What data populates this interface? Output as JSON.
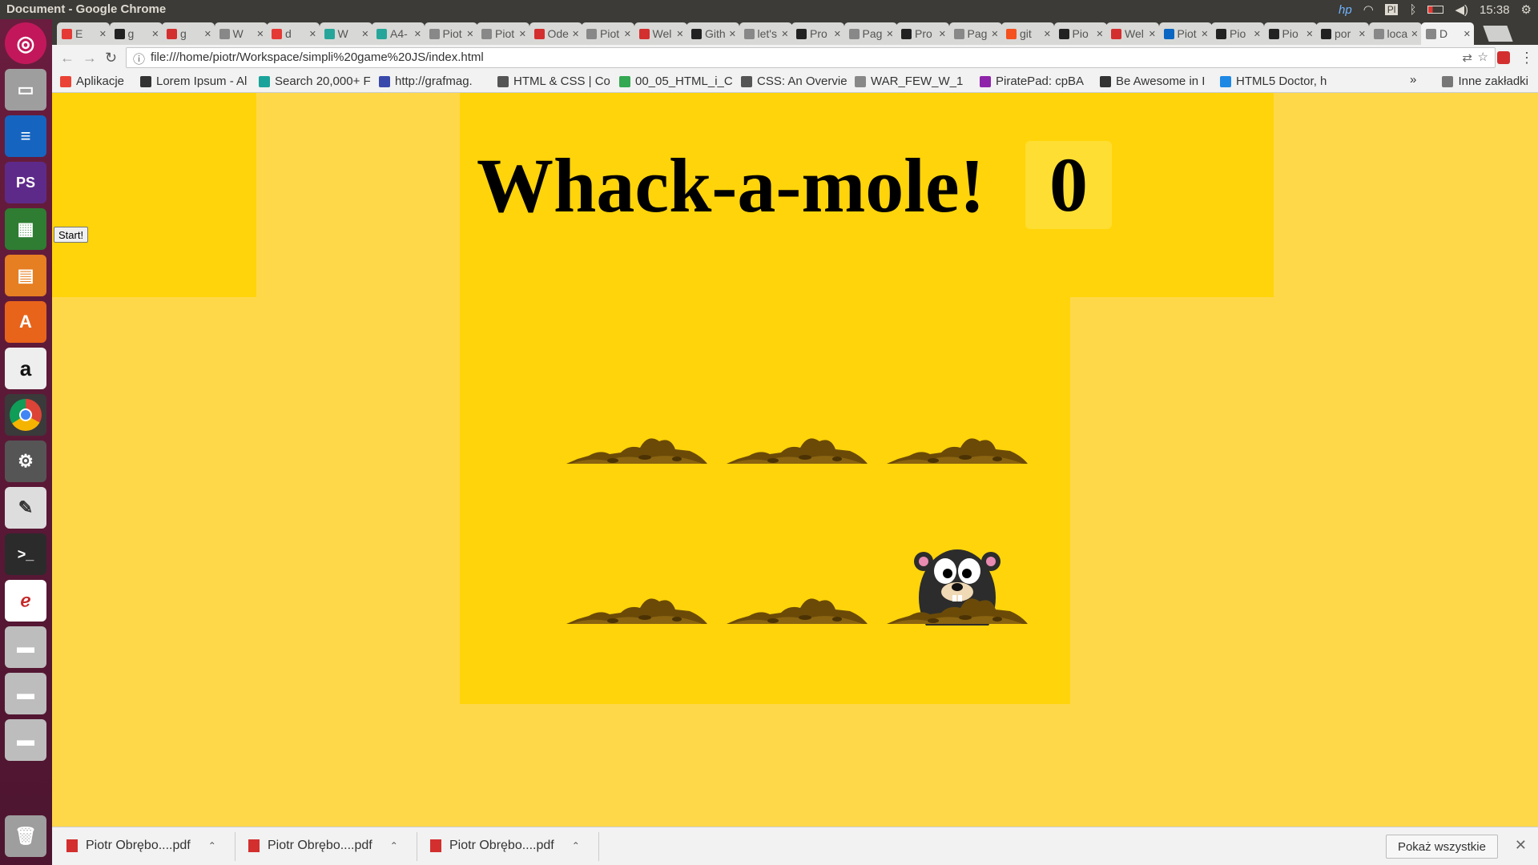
{
  "os": {
    "window_title": "Document - Google Chrome",
    "time": "15:38",
    "keyboard": "Pl"
  },
  "tabs": [
    {
      "label": "E",
      "color": "#e53935"
    },
    {
      "label": "g",
      "color": "#222"
    },
    {
      "label": "g",
      "color": "#d32f2f"
    },
    {
      "label": "W",
      "color": "#888"
    },
    {
      "label": "d",
      "color": "#e53935"
    },
    {
      "label": "W",
      "color": "#26a69a"
    },
    {
      "label": "A4-",
      "color": "#26a69a"
    },
    {
      "label": "Piot",
      "color": "#888"
    },
    {
      "label": "Piot",
      "color": "#888"
    },
    {
      "label": "Ode",
      "color": "#d32f2f"
    },
    {
      "label": "Piot",
      "color": "#888"
    },
    {
      "label": "Wel",
      "color": "#d32f2f"
    },
    {
      "label": "Gith",
      "color": "#222"
    },
    {
      "label": "let's",
      "color": "#888"
    },
    {
      "label": "Pro",
      "color": "#222"
    },
    {
      "label": "Pag",
      "color": "#888"
    },
    {
      "label": "Pro",
      "color": "#222"
    },
    {
      "label": "Pag",
      "color": "#888"
    },
    {
      "label": "git",
      "color": "#f4511e"
    },
    {
      "label": "Pio",
      "color": "#222"
    },
    {
      "label": "Wel",
      "color": "#d32f2f"
    },
    {
      "label": "Piot",
      "color": "#0a66c2"
    },
    {
      "label": "Pio",
      "color": "#222"
    },
    {
      "label": "Pio",
      "color": "#222"
    },
    {
      "label": "por",
      "color": "#222"
    },
    {
      "label": "loca",
      "color": "#888"
    },
    {
      "label": "D",
      "color": "#888"
    }
  ],
  "address": {
    "url": "file:///home/piotr/Workspace/simpli%20game%20JS/index.html"
  },
  "bookmarks": [
    {
      "label": "Aplikacje",
      "color": "#ea4335"
    },
    {
      "label": "Lorem Ipsum - Al",
      "color": "#333"
    },
    {
      "label": "Search 20,000+ F",
      "color": "#1aa39a"
    },
    {
      "label": "http://grafmag.",
      "color": "#3949ab"
    },
    {
      "label": "HTML & CSS | Co",
      "color": "#555"
    },
    {
      "label": "00_05_HTML_i_C",
      "color": "#34a853"
    },
    {
      "label": "CSS: An Overvie",
      "color": "#555"
    },
    {
      "label": "WAR_FEW_W_1",
      "color": "#888"
    },
    {
      "label": "PiratePad: cpBA",
      "color": "#8e24aa"
    },
    {
      "label": "Be Awesome in I",
      "color": "#333"
    },
    {
      "label": "HTML5 Doctor, h",
      "color": "#1e88e5"
    },
    {
      "label": "Inne zakładki",
      "color": "#777"
    }
  ],
  "game": {
    "title": "Whack-a-mole!",
    "score": "0",
    "start_label": "Start!",
    "active_mole_index": 5
  },
  "downloads": {
    "items": [
      {
        "label": "Piotr Obrębo....pdf"
      },
      {
        "label": "Piotr Obrębo....pdf"
      },
      {
        "label": "Piotr Obrębo....pdf"
      }
    ],
    "show_all": "Pokaż wszystkie"
  }
}
